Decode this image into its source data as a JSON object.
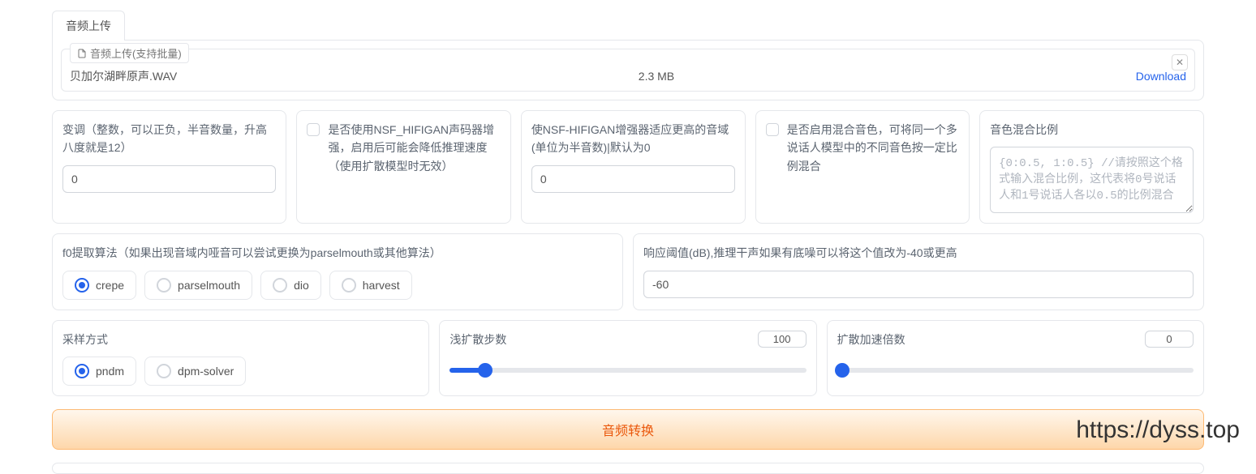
{
  "tab": {
    "label": "音频上传"
  },
  "upload": {
    "label": "音频上传(支持批量)",
    "file_name": "贝加尔湖畔原声.WAV",
    "file_size": "2.3 MB",
    "download": "Download"
  },
  "row1": {
    "pitch": {
      "label": "变调（整数，可以正负，半音数量，升高八度就是12）",
      "value": "0"
    },
    "nsf": {
      "label": "是否使用NSF_HIFIGAN声码器增强，启用后可能会降低推理速度（使用扩散模型时无效）"
    },
    "semitone": {
      "label": "使NSF-HIFIGAN增强器适应更高的音域(单位为半音数)|默认为0",
      "value": "0"
    },
    "mix": {
      "label": "是否启用混合音色，可将同一个多说话人模型中的不同音色按一定比例混合"
    },
    "ratio": {
      "label": "音色混合比例",
      "placeholder": "{0:0.5, 1:0.5} //请按照这个格式输入混合比例，这代表将0号说话人和1号说话人各以0.5的比例混合"
    }
  },
  "row2": {
    "f0": {
      "label": "f0提取算法（如果出现音域内哑音可以尝试更换为parselmouth或其他算法）",
      "options": [
        "crepe",
        "parselmouth",
        "dio",
        "harvest"
      ],
      "selected": "crepe"
    },
    "threshold": {
      "label": "响应阈值(dB),推理干声如果有底噪可以将这个值改为-40或更高",
      "value": "-60"
    }
  },
  "row3": {
    "sample": {
      "label": "采样方式",
      "options": [
        "pndm",
        "dpm-solver"
      ],
      "selected": "pndm"
    },
    "shallow": {
      "label": "浅扩散步数",
      "value": "100",
      "percent": 10
    },
    "accel": {
      "label": "扩散加速倍数",
      "value": "0",
      "percent": 0
    }
  },
  "convert": {
    "label": "音频转换"
  },
  "watermark": "https://dyss.top"
}
